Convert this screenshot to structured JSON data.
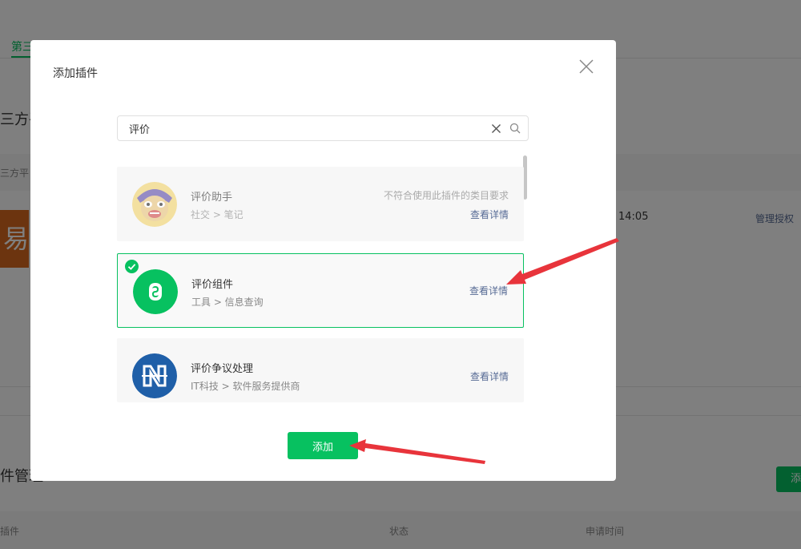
{
  "background": {
    "tab_label": "第三",
    "section_title": "三方平",
    "table_head_label": "三方平",
    "logo_text": "易",
    "row_time": "14:05",
    "manage_link": "管理授权",
    "section_title_2": "件管理",
    "add_button_label": "添",
    "columns": [
      "插件",
      "状态",
      "申请时间"
    ]
  },
  "dialog": {
    "title": "添加插件",
    "search": {
      "value": "评价"
    },
    "plugins": [
      {
        "name": "评价助手",
        "category": "社交 > 笔记",
        "warning": "不符合使用此插件的类目要求",
        "detail_label": "查看详情",
        "icon": "monkey-king-avatar-icon",
        "state": "disabled"
      },
      {
        "name": "评价组件",
        "category": "工具 > 信息查询",
        "detail_label": "查看详情",
        "icon": "mini-program-logo-icon",
        "state": "selected"
      },
      {
        "name": "评价争议处理",
        "category": "IT科技 > 软件服务提供商",
        "detail_label": "查看详情",
        "icon": "dispute-logo-icon",
        "state": "normal"
      }
    ],
    "add_button_label": "添加"
  },
  "colors": {
    "accent": "#07c160",
    "link": "#576b95",
    "annotation_arrow": "#e8343b"
  }
}
